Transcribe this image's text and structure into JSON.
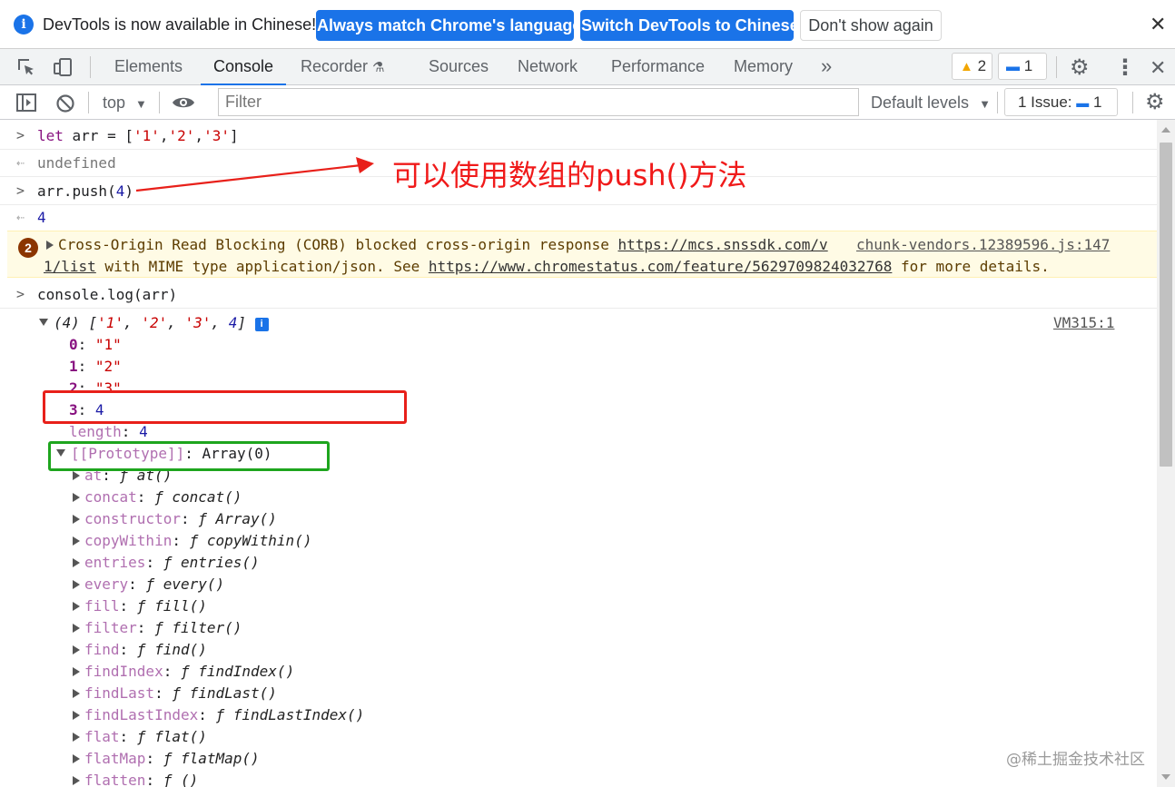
{
  "infobar": {
    "message": "DevTools is now available in Chinese!",
    "btn_match": "Always match Chrome's language",
    "btn_switch": "Switch DevTools to Chinese",
    "btn_dont_show": "Don't show again",
    "close": "✕"
  },
  "tabs": [
    "Elements",
    "Console",
    "Recorder",
    "Sources",
    "Network",
    "Performance",
    "Memory"
  ],
  "active_tab": "Console",
  "more_tabs": "»",
  "warnings_count": "2",
  "messages_count": "1",
  "toolbar": {
    "context": "top",
    "filter_placeholder": "Filter",
    "levels": "Default levels",
    "issues_label": "1 Issue:",
    "issues_count": "1"
  },
  "console": {
    "cmd1": {
      "kw": "let",
      "rest1": " arr = [",
      "s1": "'1'",
      "s2": "'2'",
      "s3": "'3'",
      "rest2": "]"
    },
    "res1": "undefined",
    "cmd2": {
      "a": "arr.push(",
      "n": "4",
      "b": ")"
    },
    "res2": "4",
    "warning": {
      "count": "2",
      "text1": "Cross-Origin Read Blocking (CORB) blocked cross-origin response ",
      "url1a": "https://mcs.snssdk.com/v",
      "url1b": "1/list",
      "text2": " with MIME type application/json. See ",
      "url2": "https://www.chromestatus.com/feature/5629709824032768",
      "text3": " for more details.",
      "source": "chunk-vendors.12389596.js:147"
    },
    "cmd3": "console.log(arr)",
    "log_source": "VM315:1",
    "array_summary": {
      "len": "(4) [",
      "v1": "'1'",
      "v2": "'2'",
      "v3": "'3'",
      "v4": "4",
      "end": "]"
    },
    "entries": [
      {
        "key": "0",
        "value": "\"1\""
      },
      {
        "key": "1",
        "value": "\"2\""
      },
      {
        "key": "2",
        "value": "\"3\""
      },
      {
        "key": "3",
        "value": "4"
      }
    ],
    "length_key": "length",
    "length_value": "4",
    "prototype_key": "[[Prototype]]",
    "prototype_value": "Array(0)",
    "methods": [
      {
        "name": "at",
        "fn": "at()"
      },
      {
        "name": "concat",
        "fn": "concat()"
      },
      {
        "name": "constructor",
        "fn": "Array()"
      },
      {
        "name": "copyWithin",
        "fn": "copyWithin()"
      },
      {
        "name": "entries",
        "fn": "entries()"
      },
      {
        "name": "every",
        "fn": "every()"
      },
      {
        "name": "fill",
        "fn": "fill()"
      },
      {
        "name": "filter",
        "fn": "filter()"
      },
      {
        "name": "find",
        "fn": "find()"
      },
      {
        "name": "findIndex",
        "fn": "findIndex()"
      },
      {
        "name": "findLast",
        "fn": "findLast()"
      },
      {
        "name": "findLastIndex",
        "fn": "findLastIndex()"
      },
      {
        "name": "flat",
        "fn": "flat()"
      },
      {
        "name": "flatMap",
        "fn": "flatMap()"
      },
      {
        "name": "flatten",
        "fn": "()"
      }
    ]
  },
  "annotation": "可以使用数组的push()方法",
  "watermark": "@稀土掘金技术社区",
  "colors": {
    "accent": "#1a73e8",
    "annotation_red": "#f01a1a",
    "box_red": "#e8201a",
    "box_green": "#1ea51e",
    "warning_bg": "#fffbe5"
  }
}
